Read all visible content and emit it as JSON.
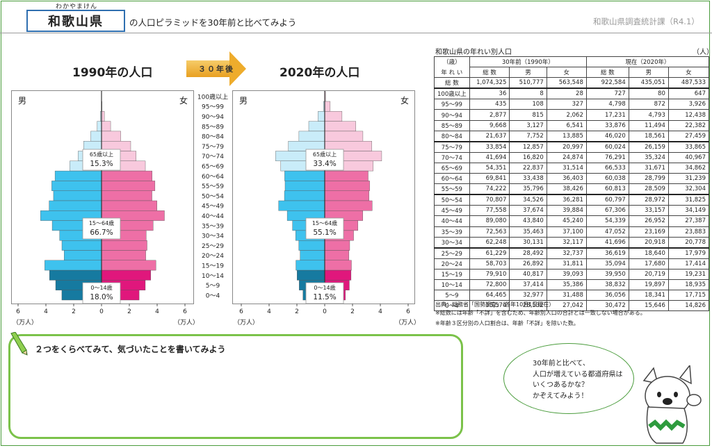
{
  "header": {
    "ruby": "わかやまけん",
    "prefecture": "和歌山県",
    "subtitle": "の人口ピラミッドを30年前と比べてみよう",
    "source_title": "和歌山県調査統計課（R4.1）"
  },
  "arrow_label": "３０年後",
  "pyramids": [
    {
      "title": "1990年の人口",
      "male_label": "男",
      "female_label": "女",
      "unit": "（万人）",
      "bands": [
        {
          "label": "65歳以上",
          "value": "15.3%"
        },
        {
          "label": "15〜64歳",
          "value": "66.7%"
        },
        {
          "label": "0〜14歳",
          "value": "18.0%"
        }
      ]
    },
    {
      "title": "2020年の人口",
      "male_label": "男",
      "female_label": "女",
      "unit": "（万人）",
      "bands": [
        {
          "label": "65歳以上",
          "value": "33.4%"
        },
        {
          "label": "15〜64歳",
          "value": "55.1%"
        },
        {
          "label": "0〜14歳",
          "value": "11.5%"
        }
      ]
    }
  ],
  "chart_data": {
    "type": "bar",
    "orientation": "horizontal-population-pyramid",
    "age_groups": [
      "100歳以上",
      "95〜99",
      "90〜94",
      "85〜89",
      "80〜84",
      "75〜79",
      "70〜74",
      "65〜69",
      "60〜64",
      "55〜59",
      "50〜54",
      "45〜49",
      "40〜44",
      "35〜39",
      "30〜34",
      "25〜29",
      "20〜24",
      "15〜19",
      "10〜14",
      "5〜9",
      "0〜4"
    ],
    "x_ticks": [
      "6",
      "4",
      "2",
      "0",
      "2",
      "4",
      "6"
    ],
    "xlim": [
      -60000,
      60000
    ],
    "xlabel": "（万人）",
    "charts": [
      {
        "title": "1990年の人口",
        "male": [
          8,
          108,
          815,
          3127,
          7752,
          12857,
          16820,
          22837,
          33438,
          35796,
          34526,
          37674,
          43840,
          35463,
          30131,
          28492,
          26892,
          40817,
          37414,
          32977,
          28532
        ],
        "female": [
          28,
          327,
          2062,
          6541,
          13885,
          20997,
          24874,
          31514,
          36403,
          38426,
          36281,
          39884,
          45240,
          37100,
          32117,
          32737,
          31811,
          39093,
          35386,
          31488,
          27042
        ]
      },
      {
        "title": "2020年の人口",
        "male": [
          80,
          872,
          4793,
          11494,
          18561,
          26159,
          35324,
          31671,
          28799,
          28509,
          28972,
          33157,
          26952,
          23169,
          20918,
          18640,
          17680,
          20719,
          19897,
          18341,
          15646
        ],
        "female": [
          647,
          3926,
          12438,
          22382,
          27459,
          33865,
          40967,
          34862,
          31239,
          32304,
          31825,
          34149,
          27387,
          23883,
          20778,
          17979,
          17414,
          19231,
          18935,
          17715,
          14826
        ]
      }
    ]
  },
  "table": {
    "title": "和歌山県の年れい別人口",
    "unit": "（人）",
    "corner_top": "（歳）",
    "corner_bottom": "年 れ い",
    "group_1990": "30年前（1990年）",
    "group_2020": "現在（2020年）",
    "col_total": "総 数",
    "col_male": "男",
    "col_female": "女",
    "total_row": {
      "label": "総 数",
      "v": [
        "1,074,325",
        "510,777",
        "563,548",
        "922,584",
        "435,051",
        "487,533"
      ]
    },
    "rows": [
      {
        "age": "100歳以上",
        "v": [
          "36",
          "8",
          "28",
          "727",
          "80",
          "647"
        ]
      },
      {
        "age": "95〜99",
        "v": [
          "435",
          "108",
          "327",
          "4,798",
          "872",
          "3,926"
        ]
      },
      {
        "age": "90〜94",
        "v": [
          "2,877",
          "815",
          "2,062",
          "17,231",
          "4,793",
          "12,438"
        ]
      },
      {
        "age": "85〜89",
        "v": [
          "9,668",
          "3,127",
          "6,541",
          "33,876",
          "11,494",
          "22,382"
        ]
      },
      {
        "age": "80〜84",
        "v": [
          "21,637",
          "7,752",
          "13,885",
          "46,020",
          "18,561",
          "27,459"
        ]
      },
      {
        "age": "75〜79",
        "v": [
          "33,854",
          "12,857",
          "20,997",
          "60,024",
          "26,159",
          "33,865"
        ]
      },
      {
        "age": "70〜74",
        "v": [
          "41,694",
          "16,820",
          "24,874",
          "76,291",
          "35,324",
          "40,967"
        ]
      },
      {
        "age": "65〜69",
        "v": [
          "54,351",
          "22,837",
          "31,514",
          "66,533",
          "31,671",
          "34,862"
        ]
      },
      {
        "age": "60〜64",
        "v": [
          "69,841",
          "33,438",
          "36,403",
          "60,038",
          "28,799",
          "31,239"
        ]
      },
      {
        "age": "55〜59",
        "v": [
          "74,222",
          "35,796",
          "38,426",
          "60,813",
          "28,509",
          "32,304"
        ]
      },
      {
        "age": "50〜54",
        "v": [
          "70,807",
          "34,526",
          "36,281",
          "60,797",
          "28,972",
          "31,825"
        ]
      },
      {
        "age": "45〜49",
        "v": [
          "77,558",
          "37,674",
          "39,884",
          "67,306",
          "33,157",
          "34,149"
        ]
      },
      {
        "age": "40〜44",
        "v": [
          "89,080",
          "43,840",
          "45,240",
          "54,339",
          "26,952",
          "27,387"
        ]
      },
      {
        "age": "35〜39",
        "v": [
          "72,563",
          "35,463",
          "37,100",
          "47,052",
          "23,169",
          "23,883"
        ]
      },
      {
        "age": "30〜34",
        "v": [
          "62,248",
          "30,131",
          "32,117",
          "41,696",
          "20,918",
          "20,778"
        ]
      },
      {
        "age": "25〜29",
        "v": [
          "61,229",
          "28,492",
          "32,737",
          "36,619",
          "18,640",
          "17,979"
        ]
      },
      {
        "age": "20〜24",
        "v": [
          "58,703",
          "26,892",
          "31,811",
          "35,094",
          "17,680",
          "17,414"
        ]
      },
      {
        "age": "15〜19",
        "v": [
          "79,910",
          "40,817",
          "39,093",
          "39,950",
          "20,719",
          "19,231"
        ]
      },
      {
        "age": "10〜14",
        "v": [
          "72,800",
          "37,414",
          "35,386",
          "38,832",
          "19,897",
          "18,935"
        ]
      },
      {
        "age": "5〜9",
        "v": [
          "64,465",
          "32,977",
          "31,488",
          "36,056",
          "18,341",
          "17,715"
        ]
      },
      {
        "age": "0〜4",
        "v": [
          "55,574",
          "28,532",
          "27,042",
          "30,472",
          "15,646",
          "14,826"
        ]
      }
    ]
  },
  "notes": [
    "出典：総務省「国勢調査」（各年10月1日現在）",
    "※総数には年齢「不詳」を含むため、年齢別人口の合計とは一致しない場合がある。",
    "※年齢３区分別の人口割合は、年齢「不詳」を除いた数。"
  ],
  "task": "２つをくらべてみて、気づいたことを書いてみよう",
  "bubble_lines": [
    "30年前と比べて、",
    "人口が増えている都道府県は",
    "いくつあるかな？",
    "かぞえてみよう！"
  ],
  "colors": {
    "male_old": "#c9ecf9",
    "male_mid": "#3ec2ee",
    "male_young": "#167aa0",
    "female_old": "#f8c9dd",
    "female_mid": "#ee6fa6",
    "female_young": "#e0177c",
    "frame": "#4a9c3c",
    "task_border": "#7bc24a",
    "arrow": "#eeac2c",
    "pref_border": "#2f6fb0"
  }
}
